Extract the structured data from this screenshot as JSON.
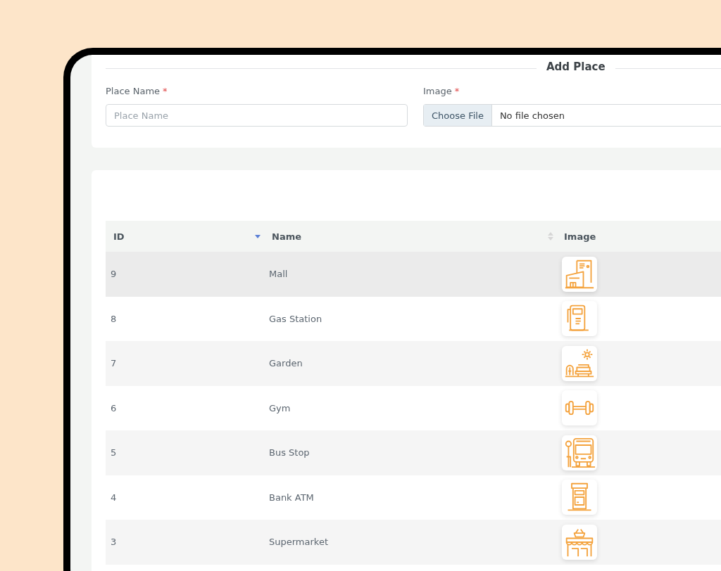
{
  "form": {
    "title": "Add Place",
    "fields": [
      {
        "label": "Place Name",
        "required_mark": "*",
        "placeholder": "Place Name",
        "kind": "text"
      },
      {
        "label": "Image",
        "required_mark": "*",
        "kind": "file",
        "button": "Choose File",
        "value": "No file chosen"
      }
    ]
  },
  "table": {
    "columns": [
      {
        "label": "ID",
        "sorted": true
      },
      {
        "label": "Name",
        "sorted": false
      },
      {
        "label": "Image"
      }
    ],
    "rows": [
      {
        "id": "9",
        "name": "Mall",
        "kind": "mall"
      },
      {
        "id": "8",
        "name": "Gas Station",
        "kind": "gas"
      },
      {
        "id": "7",
        "name": "Garden",
        "kind": "garden"
      },
      {
        "id": "6",
        "name": "Gym",
        "kind": "gym"
      },
      {
        "id": "5",
        "name": "Bus Stop",
        "kind": "bus"
      },
      {
        "id": "4",
        "name": "Bank ATM",
        "kind": "atm"
      },
      {
        "id": "3",
        "name": "Supermarket",
        "kind": "market"
      }
    ]
  }
}
